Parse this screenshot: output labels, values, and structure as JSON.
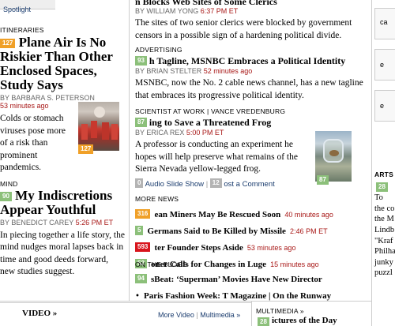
{
  "left": {
    "spotlight": "Spotlight",
    "story1": {
      "kicker": "ITINERARIES",
      "badge": "127",
      "headline": "Plane Air Is No Riskier Than Other Enclosed Spaces, Study Says",
      "byline": "By BARBARA S. PETERSON",
      "time": "53 minutes ago",
      "summary": "Colds or stomach viruses pose more of a risk than prominent pandemics.",
      "photo_badge": "127"
    },
    "story2": {
      "kicker": "MIND",
      "badge": "90",
      "headline": "My Indiscretions Appear Youthful",
      "byline": "By BENEDICT CAREY",
      "time": "5:26 PM ET",
      "summary": "In piecing together a life story, the mind nudges moral lapses back in time and good deeds forward, new studies suggest."
    }
  },
  "middle": {
    "top_story": {
      "headline": "n Blocks Web Sites of Some Clerics",
      "byline": "By WILLIAM YONG",
      "time": "6:37 PM ET",
      "summary": "The sites of two senior clerics were blocked by government censors in a possible sign of a hardening political divide."
    },
    "story_adv": {
      "kicker": "ADVERTISING",
      "badge": "93",
      "headline": "h Tagline, MSNBC Embraces a Political Identity",
      "byline": "By BRIAN STELTER",
      "time": "52 minutes ago",
      "summary": "MSNBC, now the No. 2 cable news channel, has a new tagline that embraces its progressive political identity."
    },
    "story_sci": {
      "kicker": "SCIENTIST AT WORK | VANCE VREDENBURG",
      "badge": "87",
      "headline": "ing to Save a Threatened Frog",
      "byline": "By ERICA REX",
      "time": "5:00 PM ET",
      "summary": "A professor is conducting an experiment he hopes will help preserve what remains of the Sierra Nevada yellow-legged frog.",
      "photo_badge": "87",
      "audio_badge": "0",
      "audio_label": "Audio Slide Show",
      "comment_badge": "12",
      "comment_label": "ost a Comment"
    },
    "more_news": {
      "kicker": "MORE NEWS",
      "items": [
        {
          "badge": "316",
          "title": "ean Miners May Be Rescued Soon",
          "time": "40 minutes ago"
        },
        {
          "badge": "5",
          "title": "Germans Said to Be Killed by Missile",
          "time": "2:46 PM ET"
        },
        {
          "badge": "593",
          "title": "ter Founder Steps Aside",
          "time": "53 minutes ago"
        },
        {
          "badge": "52",
          "title": "oner Calls for Changes in Luge",
          "time": "15 minutes ago"
        }
      ]
    },
    "blogs": {
      "kicker": "ON THE BLOGS",
      "items": [
        {
          "badge": "94",
          "title": "sBeat: ‘Superman’ Movies Have New Director"
        },
        {
          "badge": "",
          "title": "Paris Fashion Week: T Magazine | On the Runway"
        }
      ]
    }
  },
  "right": {
    "top_items": [
      "ca",
      "e",
      "e"
    ],
    "arts_kicker": "ARTS",
    "badge": "28",
    "lines": [
      "To",
      "the co",
      "the M",
      "Lindb",
      "\"Kraf",
      "Philha",
      "junky",
      "puzzl"
    ]
  },
  "bottom": {
    "video_label": "VIDEO »",
    "more_video": "More Video",
    "multimedia": "Multimedia »",
    "multimedia_right": "MULTIMEDIA »",
    "pictures_badge": "28",
    "pictures_title": "ictures of the Day"
  }
}
